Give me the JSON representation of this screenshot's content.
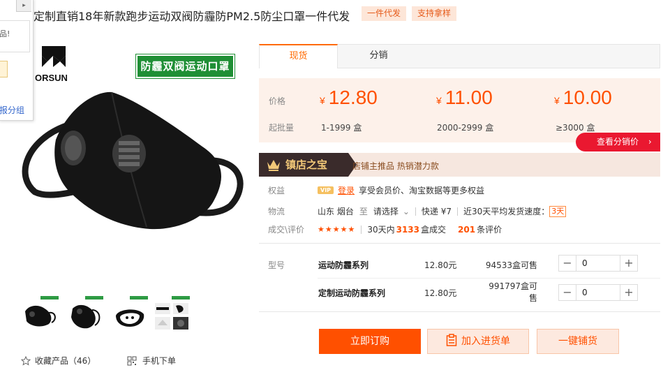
{
  "popup": {
    "close_glyph": "▸",
    "box_text": "品!",
    "link_text": "报分组"
  },
  "product": {
    "title": "定制直销18年新款跑步运动双阀防霾防PM2.5防尘口罩一件代发",
    "tags": [
      "一件代发",
      "支持拿样"
    ],
    "brand_logo_text": "ORSUN",
    "banner_text": "防霾双阀运动口罩"
  },
  "tabs": [
    {
      "label": "现货",
      "active": true
    },
    {
      "label": "分销",
      "active": false
    }
  ],
  "pricing": {
    "price_label": "价格",
    "moq_label": "起批量",
    "currency": "¥",
    "tiers": [
      {
        "price": "12.80",
        "range": "1-1999 盒"
      },
      {
        "price": "11.00",
        "range": "2000-2999 盒"
      },
      {
        "price": "10.00",
        "range": "≥3000 盒"
      }
    ],
    "view_dist_price": "查看分销价",
    "view_dist_arrow": "›"
  },
  "treasure": {
    "badge": "镇店之宝",
    "text": "店铺主推品   热销潜力款"
  },
  "info": {
    "rights_label": "权益",
    "vip_badge": "VIP",
    "login_text": "登录",
    "rights_text": "享受会员价、淘宝数据等更多权益",
    "logistics_label": "物流",
    "origin": "山东 烟台",
    "to_text": "至",
    "destination_select": "请选择",
    "express": "快递 ¥7",
    "ship_speed_text": "近30天平均发货速度：",
    "ship_speed_value": "3天",
    "deals_label": "成交\\评价",
    "stars": "★★★★★",
    "deals_prefix": "30天内",
    "deals_count": "3133",
    "deals_suffix": "盒成交",
    "reviews_count": "201",
    "reviews_suffix": "条评价"
  },
  "sku": {
    "label": "型号",
    "rows": [
      {
        "name": "运动防霾系列",
        "price": "12.80元",
        "stock": "94533盒可售",
        "qty": "0"
      },
      {
        "name": "定制运动防霾系列",
        "price": "12.80元",
        "stock": "991797盒可售",
        "qty": "0"
      }
    ]
  },
  "actions": {
    "buy_now": "立即订购",
    "add_to_cart": "加入进货单",
    "one_key": "一键铺货"
  },
  "footer": {
    "favorite_label": "收藏产品（46）",
    "mobile_order": "手机下单"
  },
  "colors": {
    "accent": "#ff5000",
    "price_bg": "#fdf1ea",
    "treasure_dark": "#3a2b2b",
    "dist_button": "#ea1830"
  }
}
